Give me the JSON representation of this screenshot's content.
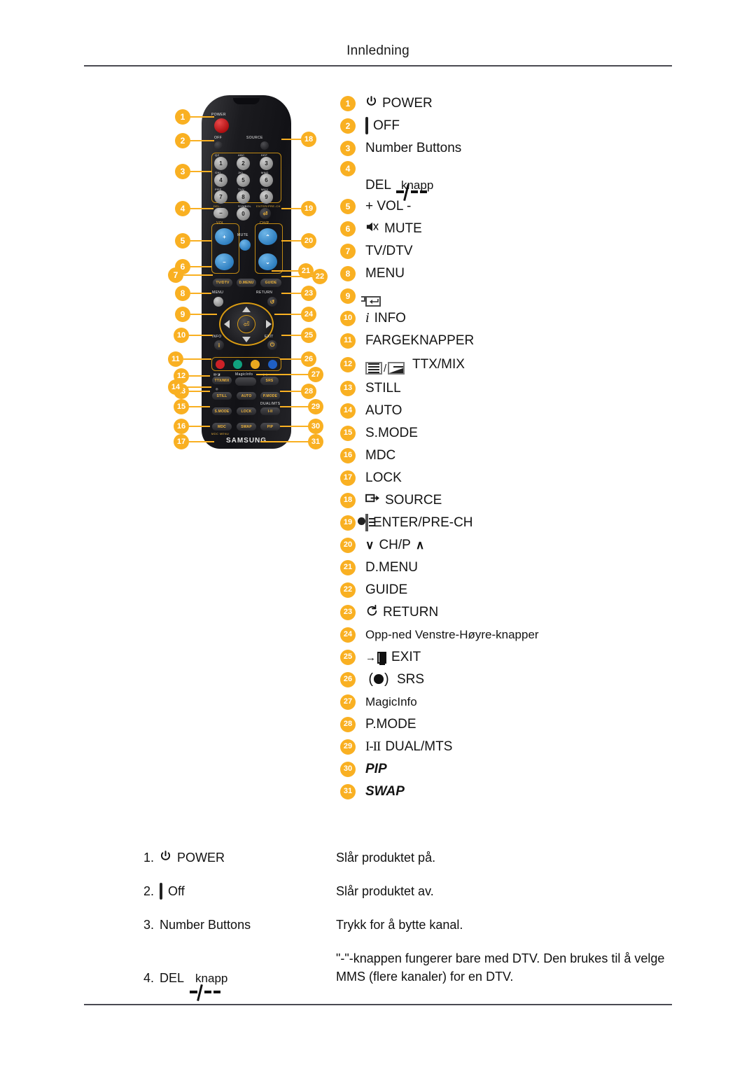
{
  "header": {
    "title": "Innledning"
  },
  "legend": {
    "items": [
      {
        "n": "1",
        "label": "POWER",
        "icon": "power-icon",
        "indent": 2,
        "style": ""
      },
      {
        "n": "2",
        "label": "OFF",
        "icon": "off-box-icon",
        "indent": 1,
        "style": ""
      },
      {
        "n": "3",
        "label": "Number Buttons",
        "icon": "",
        "indent": 1,
        "style": ""
      },
      {
        "n": "4",
        "label": "DEL",
        "label2": "knapp",
        "icon": "del-dash-icon",
        "indent": 1,
        "style": ""
      },
      {
        "n": "5",
        "label": "+ VOL -",
        "icon": "",
        "indent": 1,
        "style": ""
      },
      {
        "n": "6",
        "label": "MUTE",
        "icon": "mute-icon",
        "indent": 1,
        "style": ""
      },
      {
        "n": "7",
        "label": "TV/DTV",
        "icon": "",
        "indent": 1,
        "style": ""
      },
      {
        "n": "8",
        "label": "MENU",
        "icon": "",
        "indent": 1,
        "style": ""
      },
      {
        "n": "9",
        "label": "",
        "icon": "enter-key-icon",
        "indent": 2,
        "style": ""
      },
      {
        "n": "10",
        "label": "INFO",
        "icon": "info-i-icon",
        "indent": 2,
        "style": ""
      },
      {
        "n": "11",
        "label": "FARGEKNAPPER",
        "icon": "",
        "indent": 1,
        "style": ""
      },
      {
        "n": "12",
        "label": "TTX/MIX",
        "icon": "ttx-mix-icon",
        "indent": 1,
        "style": ""
      },
      {
        "n": "13",
        "label": "STILL",
        "icon": "",
        "indent": 1,
        "style": ""
      },
      {
        "n": "14",
        "label": "AUTO",
        "icon": "",
        "indent": 1,
        "style": ""
      },
      {
        "n": "15",
        "label": "S.MODE",
        "icon": "",
        "indent": 1,
        "style": ""
      },
      {
        "n": "16",
        "label": "MDC",
        "icon": "",
        "indent": 1,
        "style": ""
      },
      {
        "n": "17",
        "label": "LOCK",
        "icon": "",
        "indent": 1,
        "style": ""
      },
      {
        "n": "18",
        "label": "SOURCE",
        "icon": "source-icon",
        "indent": 1,
        "style": ""
      },
      {
        "n": "19",
        "label": "ENTER/PRE-CH",
        "icon": "enter-prech-icon",
        "indent": 1,
        "style": ""
      },
      {
        "n": "20",
        "label": "CH/P",
        "icon": "ch-p-arrows-icon",
        "indent": 1,
        "style": ""
      },
      {
        "n": "21",
        "label": "D.MENU",
        "icon": "",
        "indent": 1,
        "style": ""
      },
      {
        "n": "22",
        "label": "GUIDE",
        "icon": "",
        "indent": 1,
        "style": ""
      },
      {
        "n": "23",
        "label": "RETURN",
        "icon": "return-icon",
        "indent": 2,
        "style": ""
      },
      {
        "n": "24",
        "label": "Opp-ned Venstre-Høyre-knapper",
        "icon": "",
        "indent": 1,
        "style": "small"
      },
      {
        "n": "25",
        "label": "EXIT",
        "icon": "exit-icon",
        "indent": 1,
        "style": ""
      },
      {
        "n": "26",
        "label": "SRS",
        "icon": "srs-icon",
        "indent": 1,
        "style": ""
      },
      {
        "n": "27",
        "label": "MagicInfo",
        "icon": "",
        "indent": 1,
        "style": "small"
      },
      {
        "n": "28",
        "label": "P.MODE",
        "icon": "",
        "indent": 1,
        "style": ""
      },
      {
        "n": "29",
        "label": "DUAL/MTS",
        "icon": "dual-mts-icon",
        "indent": 1,
        "style": ""
      },
      {
        "n": "30",
        "label": "PIP",
        "icon": "",
        "indent": 1,
        "style": "italic"
      },
      {
        "n": "31",
        "label": "SWAP",
        "icon": "",
        "indent": 1,
        "style": "italic"
      }
    ]
  },
  "descriptions": [
    {
      "num": "1.",
      "name": "POWER",
      "icon": "power-icon",
      "text": "Slår produktet på."
    },
    {
      "num": "2.",
      "name": "Off",
      "icon": "off-box-icon",
      "text": "Slår produktet av."
    },
    {
      "num": "3.",
      "name": "Number Buttons",
      "icon": "",
      "text": "Trykk for å bytte kanal."
    },
    {
      "num": "4.",
      "name": "DEL",
      "name2": "knapp",
      "icon": "del-dash-icon",
      "text": "\"-\"-knappen fungerer bare med DTV. Den brukes til å velge MMS (flere kanaler) for en DTV."
    }
  ],
  "remote": {
    "brand": "SAMSUNG",
    "labels": {
      "power": "POWER",
      "off": "OFF",
      "source": "SOURCE",
      "vol": "VOL",
      "mute": "MUTE",
      "chp": "CH/P",
      "tvdtv": "TV/DTV",
      "dmenu": "D.MENU",
      "guide": "GUIDE",
      "menu": "MENU",
      "return": "RETURN",
      "info": "INFO",
      "exit": "EXIT",
      "ttxmix": "TTX/MIX",
      "magicinfo": "MagicInfo",
      "srs": "SRS",
      "still": "STILL",
      "auto": "AUTO",
      "pmode": "P.MODE",
      "smode": "S.MODE",
      "lock": "LOCK",
      "dualmts": "DUAL/MTS",
      "dualglyph": "I-II",
      "mdc": "MDC",
      "mdcsub": "MDC MENU",
      "swap": "SWAP",
      "pip": "PIP"
    },
    "keypad": {
      "digits": [
        "1",
        "2",
        "3",
        "4",
        "5",
        "6",
        "7",
        "8",
        "9",
        "0"
      ],
      "sublabels": [
        "QZ",
        "ABC",
        "DEF",
        "GHI",
        "JKL",
        "MNO",
        "PRS",
        "TUV",
        "WXY",
        "SYMBOL"
      ],
      "del_label": "DEL-",
      "enter_label": "ENTER/PRE-CH"
    },
    "color_buttons": [
      "#cc2127",
      "#10a07e",
      "#e9a81f",
      "#1f5fc4"
    ],
    "callouts_left": [
      "1",
      "2",
      "3",
      "4",
      "5",
      "6",
      "7",
      "8",
      "9",
      "10",
      "11",
      "12",
      "13",
      "14",
      "15",
      "16",
      "17"
    ],
    "callouts_right": [
      "18",
      "19",
      "20",
      "21",
      "22",
      "23",
      "24",
      "25",
      "26",
      "27",
      "28",
      "29",
      "30",
      "31"
    ]
  },
  "colors": {
    "badge": "#f9b022",
    "text": "#141414",
    "rule": "#4a4a52"
  }
}
